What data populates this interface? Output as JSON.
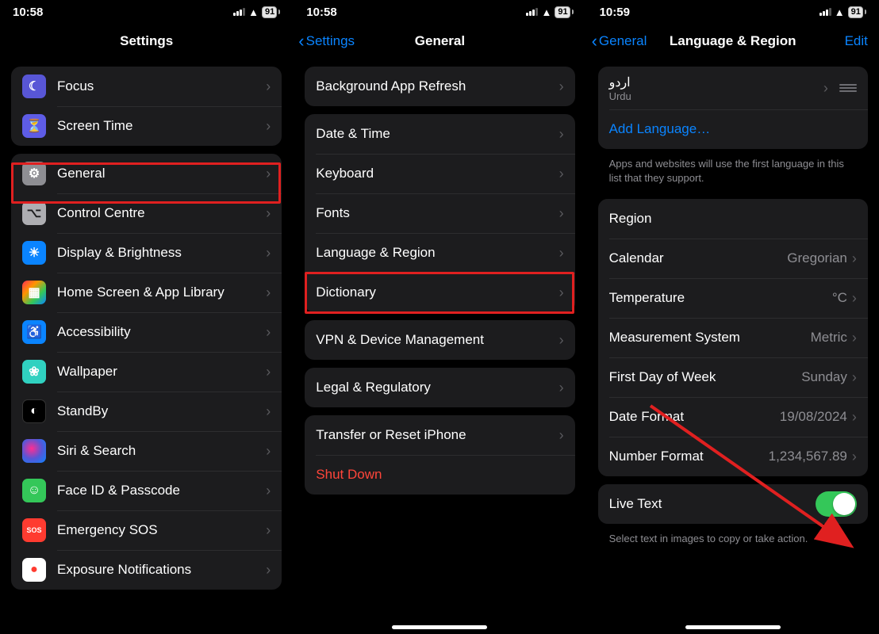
{
  "status": {
    "time1": "10:58",
    "time2": "10:58",
    "time3": "10:59",
    "battery": "91"
  },
  "screen1": {
    "title": "Settings",
    "items_a": [
      {
        "label": "Focus",
        "icon": "moon-icon",
        "cls": "bg-purple",
        "glyph": "☾"
      },
      {
        "label": "Screen Time",
        "icon": "hourglass-icon",
        "cls": "bg-indigo",
        "glyph": "⏳"
      }
    ],
    "items_b": [
      {
        "label": "General",
        "icon": "gear-icon",
        "cls": "bg-gray",
        "glyph": "⚙"
      },
      {
        "label": "Control Centre",
        "icon": "control-centre-icon",
        "cls": "bg-gray2",
        "glyph": "⌥"
      },
      {
        "label": "Display & Brightness",
        "icon": "display-brightness-icon",
        "cls": "bg-blue",
        "glyph": "☀"
      },
      {
        "label": "Home Screen & App Library",
        "icon": "home-screen-icon",
        "cls": "bg-multicolor",
        "glyph": "▦"
      },
      {
        "label": "Accessibility",
        "icon": "accessibility-icon",
        "cls": "bg-blue",
        "glyph": "♿"
      },
      {
        "label": "Wallpaper",
        "icon": "wallpaper-icon",
        "cls": "bg-teal",
        "glyph": "❀"
      },
      {
        "label": "StandBy",
        "icon": "standby-icon",
        "cls": "bg-black",
        "glyph": "◐"
      },
      {
        "label": "Siri & Search",
        "icon": "siri-icon",
        "cls": "bg-siri",
        "glyph": ""
      },
      {
        "label": "Face ID & Passcode",
        "icon": "faceid-icon",
        "cls": "bg-green",
        "glyph": "☺"
      },
      {
        "label": "Emergency SOS",
        "icon": "sos-icon",
        "cls": "bg-red",
        "glyph": "SOS"
      },
      {
        "label": "Exposure Notifications",
        "icon": "exposure-icon",
        "cls": "bg-white",
        "glyph": "●"
      }
    ]
  },
  "screen2": {
    "back": "Settings",
    "title": "General",
    "group1": [
      {
        "label": "Background App Refresh"
      }
    ],
    "group2": [
      {
        "label": "Date & Time"
      },
      {
        "label": "Keyboard"
      },
      {
        "label": "Fonts"
      },
      {
        "label": "Language & Region"
      },
      {
        "label": "Dictionary"
      }
    ],
    "group3": [
      {
        "label": "VPN & Device Management"
      }
    ],
    "group4": [
      {
        "label": "Legal & Regulatory"
      }
    ],
    "group5": [
      {
        "label": "Transfer or Reset iPhone",
        "kind": "normal"
      },
      {
        "label": "Shut Down",
        "kind": "destructive"
      }
    ]
  },
  "screen3": {
    "back": "General",
    "title": "Language & Region",
    "edit": "Edit",
    "lang": {
      "native": "اردو",
      "english": "Urdu"
    },
    "add_lang": "Add Language…",
    "lang_footer": "Apps and websites will use the first language in this list that they support.",
    "region_rows": [
      {
        "label": "Region",
        "value": "",
        "heading": true
      },
      {
        "label": "Calendar",
        "value": "Gregorian"
      },
      {
        "label": "Temperature",
        "value": "°C"
      },
      {
        "label": "Measurement System",
        "value": "Metric"
      },
      {
        "label": "First Day of Week",
        "value": "Sunday"
      },
      {
        "label": "Date Format",
        "value": "19/08/2024"
      },
      {
        "label": "Number Format",
        "value": "1,234,567.89"
      }
    ],
    "live_text": "Live Text",
    "live_text_footer": "Select text in images to copy or take action."
  }
}
